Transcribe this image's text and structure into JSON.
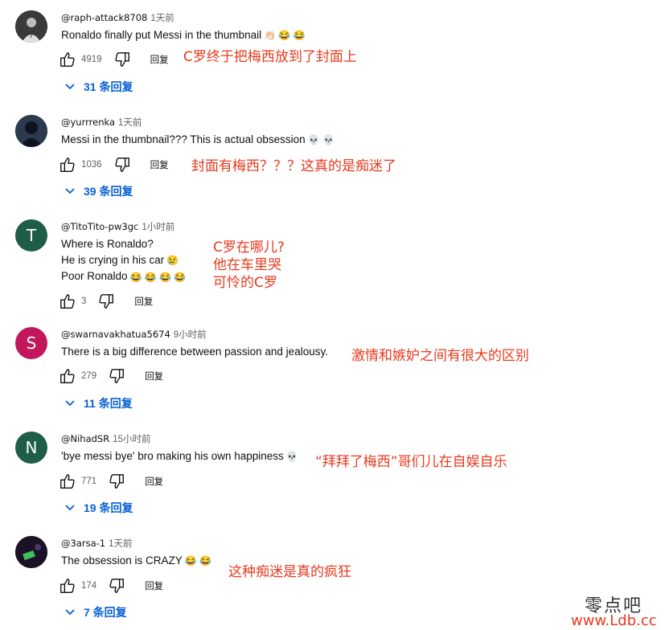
{
  "comments": [
    {
      "author": "@raph-attack8708",
      "time": "1天前",
      "lines": [
        "Ronaldo finally put Messi in the thumbnail"
      ],
      "emoji": "👏🏻 😂 😂",
      "likes": "4919",
      "reply_label": "回复",
      "replies_label": "31 条回复",
      "annotation": [
        "C罗终于把梅西放到了封面上"
      ],
      "avatar_color": "#2b2b2b",
      "avatar_letter": ""
    },
    {
      "author": "@yurrrenka",
      "time": "1天前",
      "lines": [
        "Messi in the thumbnail??? This is actual obsession"
      ],
      "emoji": "💀 💀",
      "likes": "1036",
      "reply_label": "回复",
      "replies_label": "39 条回复",
      "annotation": [
        "封面有梅西？？？这真的是痴迷了"
      ],
      "avatar_color": "#1c2a3a",
      "avatar_letter": ""
    },
    {
      "author": "@TitoTito-pw3gc",
      "time": "1小时前",
      "lines": [
        "Where is Ronaldo?",
        "He is crying in his car",
        "Poor Ronaldo"
      ],
      "emoji": "",
      "line_emoji": [
        "",
        "😢",
        "😂 😂 😂 😂"
      ],
      "likes": "3",
      "reply_label": "回复",
      "replies_label": "",
      "annotation": [
        "C罗在哪儿?",
        "他在车里哭",
        "可怜的C罗"
      ],
      "avatar_color": "#1e5e46",
      "avatar_letter": "T"
    },
    {
      "author": "@swarnavakhatua5674",
      "time": "9小时前",
      "lines": [
        "There is a big difference between passion and jealousy."
      ],
      "emoji": "",
      "likes": "279",
      "reply_label": "回复",
      "replies_label": "11 条回复",
      "annotation": [
        "激情和嫉妒之间有很大的区别"
      ],
      "avatar_color": "#c2185b",
      "avatar_letter": "S"
    },
    {
      "author": "@NihadSR",
      "time": "15小时前",
      "lines": [
        "'bye messi bye' bro making his own happiness"
      ],
      "emoji": "💀",
      "likes": "771",
      "reply_label": "回复",
      "replies_label": "19 条回复",
      "annotation": [
        "“拜拜了梅西”哥们儿在自娱自乐"
      ],
      "avatar_color": "#1e5e46",
      "avatar_letter": "N"
    },
    {
      "author": "@3arsa-1",
      "time": "1天前",
      "lines": [
        "The obsession is CRAZY"
      ],
      "emoji": "😂 😂",
      "likes": "174",
      "reply_label": "回复",
      "replies_label": "7 条回复",
      "annotation": [
        "这种痴迷是真的疯狂"
      ],
      "avatar_color": "#2a1a3a",
      "avatar_letter": ""
    }
  ],
  "watermark": {
    "top": "零点吧",
    "bottom": "www.Ldb.cc"
  },
  "colors": {
    "annotation": "#e8391d",
    "link": "#065fd4",
    "muted": "#606060"
  }
}
